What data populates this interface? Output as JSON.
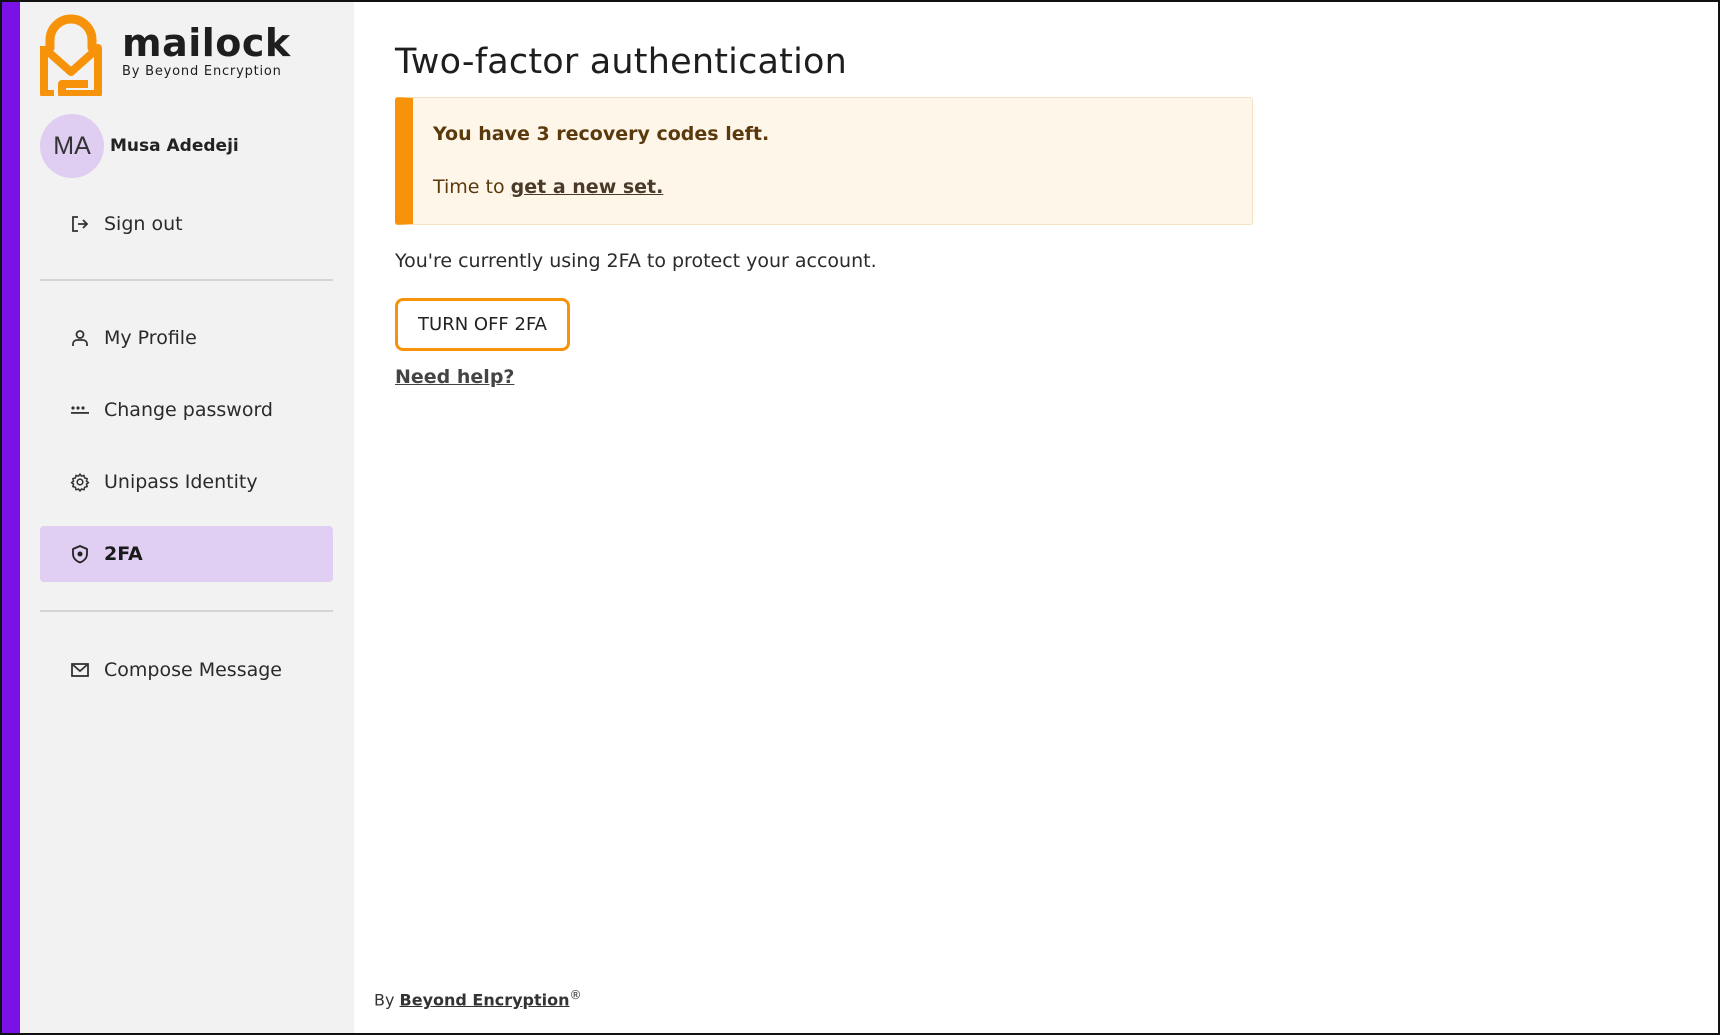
{
  "brand": {
    "name": "mailock",
    "tagline": "By Beyond Encryption",
    "accent_color": "#7a12e8",
    "brand_orange": "#f7930a"
  },
  "user": {
    "initials": "MA",
    "name": "Musa Adedeji"
  },
  "sidebar": {
    "sign_out": {
      "label": "Sign out",
      "icon": "sign-out-icon"
    },
    "items": [
      {
        "label": "My Profile",
        "icon": "person-icon"
      },
      {
        "label": "Change password",
        "icon": "password-dots-icon"
      },
      {
        "label": "Unipass Identity",
        "icon": "gear-icon"
      },
      {
        "label": "2FA",
        "icon": "shield-icon",
        "active": true
      }
    ],
    "compose": {
      "label": "Compose Message",
      "icon": "envelope-icon"
    }
  },
  "main": {
    "title": "Two-factor authentication",
    "alert": {
      "title": "You have 3 recovery codes left.",
      "body_prefix": "Time to ",
      "body_link": "get a new set."
    },
    "status": "You're currently using 2FA to protect your account.",
    "turn_off_button": "TURN OFF 2FA",
    "help_link": "Need help?"
  },
  "footer": {
    "prefix": "By ",
    "link": "Beyond Encryption",
    "mark": "®"
  }
}
